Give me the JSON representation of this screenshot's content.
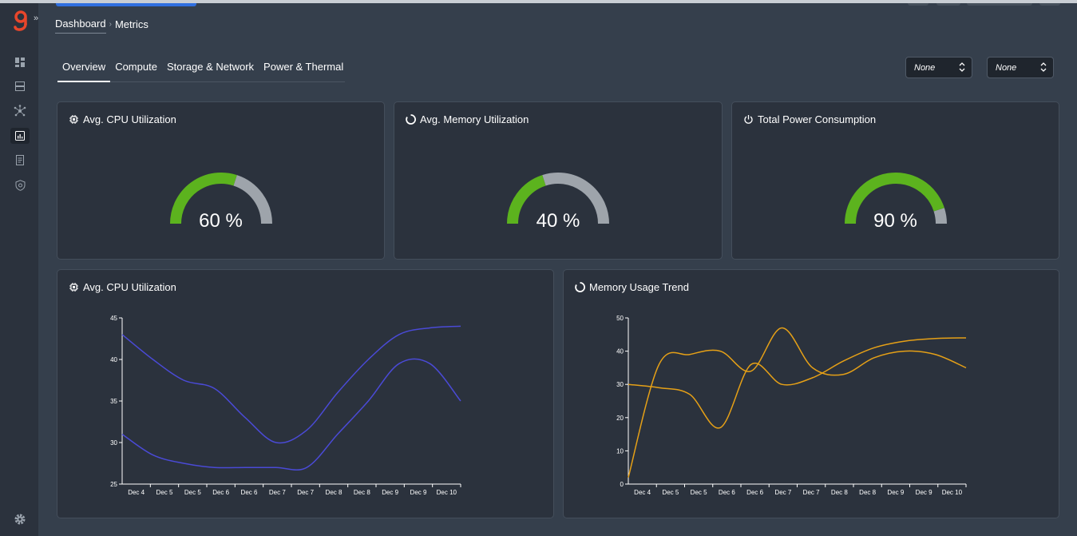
{
  "breadcrumb": {
    "root": "Dashboard",
    "current": "Metrics"
  },
  "tabs": [
    {
      "label": "Overview",
      "active": true
    },
    {
      "label": "Compute",
      "active": false
    },
    {
      "label": "Storage & Network",
      "active": false
    },
    {
      "label": "Power & Thermal",
      "active": false
    }
  ],
  "filters": [
    {
      "value": "None"
    },
    {
      "value": "None"
    }
  ],
  "sidebar": {
    "items": [
      {
        "icon": "dashboard-icon",
        "active": false
      },
      {
        "icon": "servers-icon",
        "active": false
      },
      {
        "icon": "topology-icon",
        "active": false
      },
      {
        "icon": "metrics-icon",
        "active": true
      },
      {
        "icon": "reports-icon",
        "active": false
      },
      {
        "icon": "security-icon",
        "active": false
      }
    ],
    "footer_icon": "gear-icon"
  },
  "gauges": [
    {
      "title": "Avg. CPU Utilization",
      "icon": "cpu-icon",
      "value": 60,
      "display": "60 %"
    },
    {
      "title": "Avg. Memory Utilization",
      "icon": "memory-ring-icon",
      "value": 40,
      "display": "40 %"
    },
    {
      "title": "Total Power Consumption",
      "icon": "power-icon",
      "value": 90,
      "display": "90 %"
    }
  ],
  "colors": {
    "gauge_fill": "#5cb31e",
    "gauge_track": "#9ea4ab",
    "cpu_line": "#4a4ad6",
    "memory_line": "#e5a017",
    "brand": "#e8462b"
  },
  "charts": {
    "cpu": {
      "title": "Avg. CPU Utilization",
      "icon": "cpu-icon"
    },
    "memory": {
      "title": "Memory Usage Trend",
      "icon": "memory-ring-icon"
    }
  },
  "chart_data": [
    {
      "type": "line",
      "title": "Avg. CPU Utilization",
      "categories": [
        "Dec 4",
        "Dec 5",
        "Dec 5",
        "Dec 6",
        "Dec 6",
        "Dec 7",
        "Dec 7",
        "Dec 8",
        "Dec 8",
        "Dec 9",
        "Dec 9",
        "Dec 10"
      ],
      "ylim": [
        25,
        45
      ],
      "yticks": [
        25,
        30,
        35,
        40,
        45
      ],
      "series": [
        {
          "values": [
            43,
            40,
            37.5,
            36.5,
            33,
            30,
            31.5,
            36,
            40,
            43,
            43.8,
            44
          ]
        },
        {
          "values": [
            31,
            28.5,
            27.5,
            27,
            27,
            27,
            27,
            31,
            35,
            39.5,
            39.5,
            35
          ]
        }
      ],
      "color": "#4a4ad6"
    },
    {
      "type": "line",
      "title": "Memory Usage Trend",
      "categories": [
        "Dec 4",
        "Dec 5",
        "Dec 5",
        "Dec 6",
        "Dec 6",
        "Dec 7",
        "Dec 7",
        "Dec 8",
        "Dec 8",
        "Dec 9",
        "Dec 9",
        "Dec 10"
      ],
      "ylim": [
        0,
        50
      ],
      "yticks": [
        0,
        10,
        20,
        30,
        40,
        50
      ],
      "series": [
        {
          "values": [
            30,
            29,
            27,
            17,
            36,
            30,
            32,
            37,
            41,
            43,
            43.8,
            44
          ]
        },
        {
          "values": [
            2,
            36,
            39,
            40,
            34,
            47,
            35,
            33,
            38,
            40,
            39,
            35
          ]
        }
      ],
      "color": "#e5a017"
    }
  ]
}
